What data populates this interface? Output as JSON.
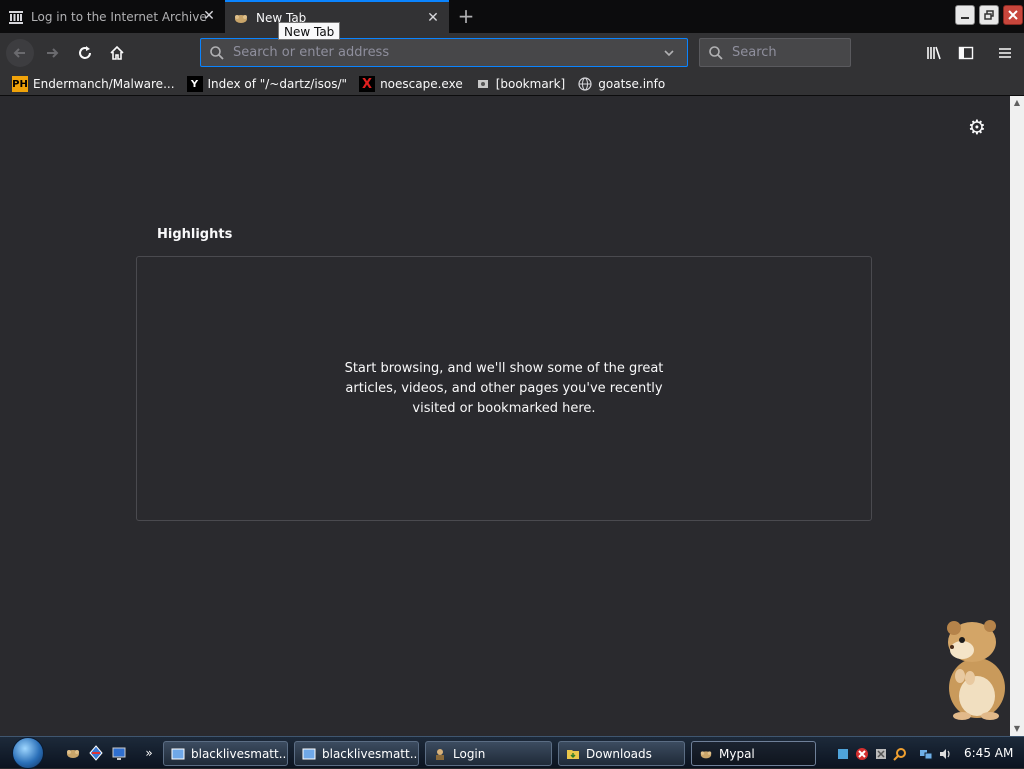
{
  "tabs": [
    {
      "title": "Log in to the Internet Archive",
      "active": false,
      "icon": "archive-icon"
    },
    {
      "title": "New Tab",
      "active": true,
      "icon": "hamster-favicon-icon"
    }
  ],
  "tooltip": "New Tab",
  "urlbar": {
    "placeholder": "Search or enter address"
  },
  "searchbar": {
    "placeholder": "Search"
  },
  "bookmarks": [
    {
      "label": "Endermanch/Malware...",
      "icon_text": "PH"
    },
    {
      "label": "Index of \"/~dartz/isos/\"",
      "icon_text": "Y"
    },
    {
      "label": "noescape.exe",
      "icon_text": "X"
    },
    {
      "label": "[bookmark]",
      "icon_text": ""
    },
    {
      "label": "goatse.info",
      "icon_text": ""
    }
  ],
  "highlights": {
    "title": "Highlights",
    "empty_message": "Start browsing, and we'll show some of the great articles, videos, and other pages you've recently visited or bookmarked here."
  },
  "taskbar": {
    "items": [
      {
        "label": "blacklivesmatt...",
        "active": false
      },
      {
        "label": "blacklivesmatt...",
        "active": false
      },
      {
        "label": "Login",
        "active": false
      },
      {
        "label": "Downloads",
        "active": false
      },
      {
        "label": "Mypal",
        "active": true
      }
    ],
    "clock": "6:45 AM"
  },
  "colors": {
    "accent": "#0a84ff",
    "content_bg": "#2a2a2e",
    "toolbar_bg": "#323234"
  }
}
